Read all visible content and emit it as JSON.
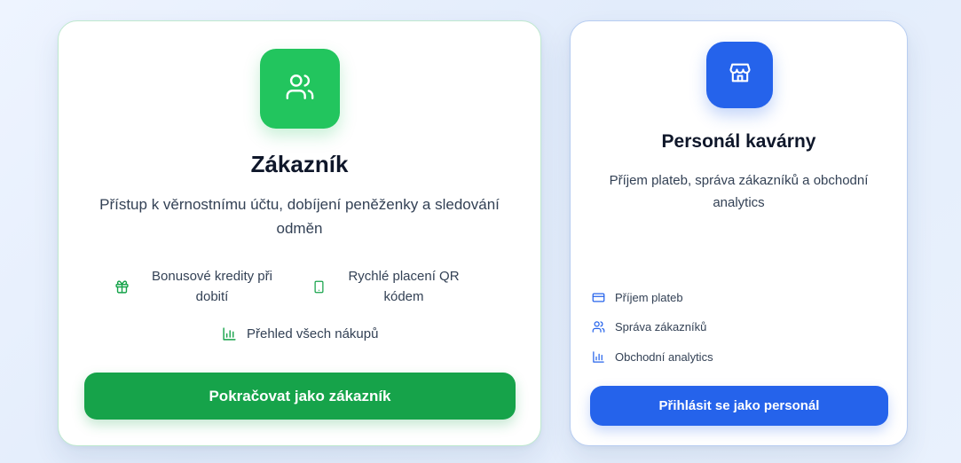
{
  "customer": {
    "icon": "users-icon",
    "title": "Zákazník",
    "description": "Přístup k věrnostnímu účtu, dobíjení peněženky a sledování odměn",
    "features": [
      {
        "icon": "gift-icon",
        "label": "Bonusové kredity při dobití"
      },
      {
        "icon": "smartphone-icon",
        "label": "Rychlé placení QR kódem"
      },
      {
        "icon": "bar-chart-icon",
        "label": "Přehled všech nákupů"
      }
    ],
    "button_label": "Pokračovat jako zákazník",
    "accent": "#22c55e",
    "button_color": "#16a34a"
  },
  "staff": {
    "icon": "store-icon",
    "title": "Personál kavárny",
    "description": "Příjem plateb, správa zákazníků a obchodní analytics",
    "features": [
      {
        "icon": "credit-card-icon",
        "label": "Příjem plateb"
      },
      {
        "icon": "users-icon",
        "label": "Správa zákazníků"
      },
      {
        "icon": "bar-chart-icon",
        "label": "Obchodní analytics"
      }
    ],
    "button_label": "Přihlásit se jako personál",
    "accent": "#2563eb"
  }
}
